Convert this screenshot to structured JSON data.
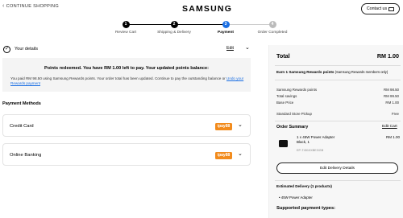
{
  "header": {
    "continue_label": "CONTINUE SHOPPING",
    "logo": "SAMSUNG",
    "contact_label": "Contact us"
  },
  "steps": [
    {
      "num": "1",
      "label": "Review Cart",
      "state": "done"
    },
    {
      "num": "2",
      "label": "Shipping & Delivery",
      "state": "done"
    },
    {
      "num": "3",
      "label": "Payment",
      "state": "active"
    },
    {
      "num": "4",
      "label": "Order Completed",
      "state": "pending"
    }
  ],
  "details": {
    "title": "Your details",
    "edit_label": "Edit"
  },
  "points": {
    "title": "Points redeemed. You have RM 1.00 left to pay. Your updated points balance:",
    "body": "You paid RM 98.50 using Samsung Rewards points. Your order total has been updated. Continue to pay the outstanding balance or",
    "link": "Undo your Rewards payment"
  },
  "payment_methods": {
    "title": "Payment Methods",
    "items": [
      {
        "label": "Credit Card",
        "badge": "ipay88"
      },
      {
        "label": "Online Banking",
        "badge": "ipay88"
      }
    ]
  },
  "summary": {
    "total_label": "Total",
    "total_value": "RM 1.00",
    "earn_text": "Earn 1 Samsung Rewards points",
    "earn_note": "(Samsung Rewards members only)",
    "rows": [
      {
        "label": "Samsung Rewards points",
        "value": "RM 98.50"
      },
      {
        "label": "Total savings",
        "value": "RM 99.50"
      },
      {
        "label": "Base Price",
        "value": "RM 1.00"
      },
      {
        "label": "Standard Store Pickup",
        "value": "Free"
      }
    ],
    "order_summary_label": "Order Summary",
    "edit_cart_label": "Edit Cart",
    "product": {
      "name_line1": "1 x 45W Power Adapter",
      "name_line2": "Black, 1",
      "sku": "EP-T4510XBEGGB",
      "price": "RM 1.00"
    },
    "edit_delivery_label": "Edit Delivery Details",
    "estimated_label": "Estimated Delivery (1 products)",
    "estimated_item": "• 45W Power Adapter",
    "supported_label": "Supported payment types:"
  },
  "colors": {
    "accent": "#1b6fe3",
    "ipay_orange": "#f28b1c"
  }
}
